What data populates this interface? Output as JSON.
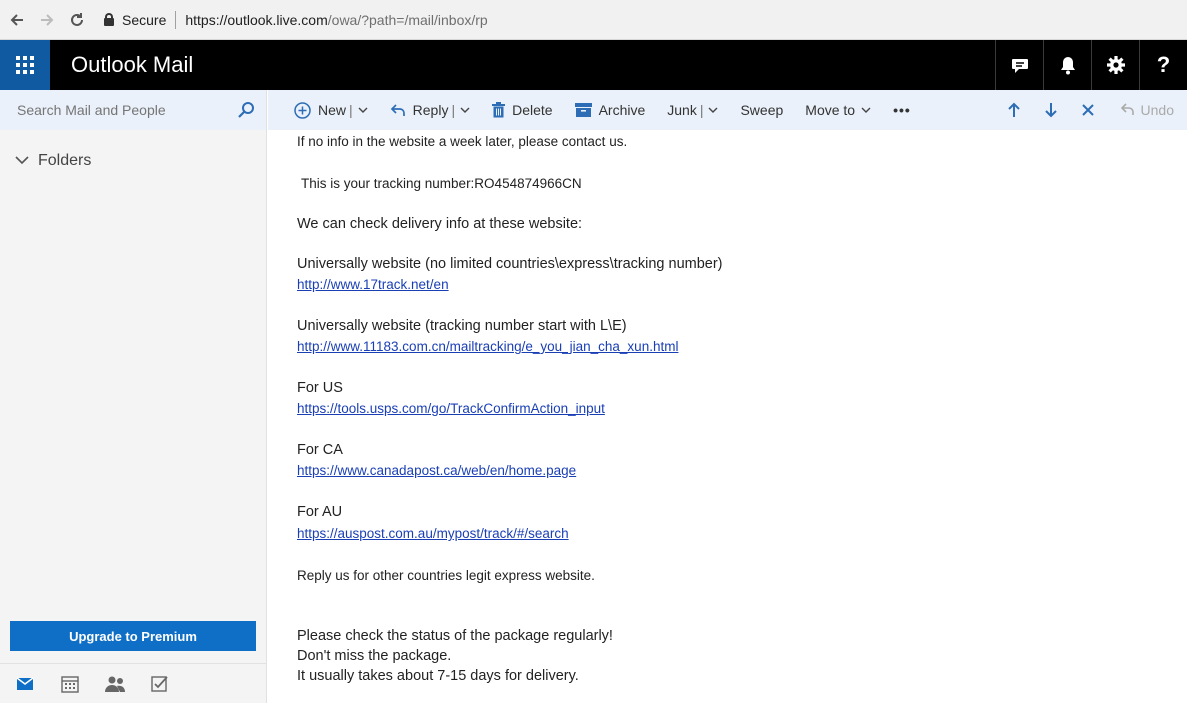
{
  "browser": {
    "secure_label": "Secure",
    "url_host": "https://outlook.live.com",
    "url_path": "/owa/?path=/mail/inbox/rp"
  },
  "header": {
    "app_title": "Outlook Mail",
    "help_label": "?"
  },
  "sidebar": {
    "search_placeholder": "Search Mail and People",
    "folders_label": "Folders",
    "upgrade_label": "Upgrade to Premium"
  },
  "toolbar": {
    "new_label": "New",
    "reply_label": "Reply",
    "delete_label": "Delete",
    "archive_label": "Archive",
    "junk_label": "Junk",
    "sweep_label": "Sweep",
    "moveto_label": "Move to",
    "more_label": "•••",
    "undo_label": "Undo",
    "separator": "|"
  },
  "message": {
    "line_contact": "If no info in the website a week later, please contact us.",
    "tracking_number": "This is your tracking number:RO454874966CN",
    "check_info": "We can check delivery info at these website:",
    "site1_label": "Universally website (no limited countries\\express\\tracking number)",
    "site1_url": "http://www.17track.net/en",
    "site2_label": "Universally website (tracking number start with L\\E)",
    "site2_url": "http://www.11183.com.cn/mailtracking/e_you_jian_cha_xun.html",
    "us_label": "For US",
    "us_url": "https://tools.usps.com/go/TrackConfirmAction_input",
    "ca_label": "For CA",
    "ca_url": "https://www.canadapost.ca/web/en/home.page",
    "au_label": "For AU",
    "au_url": "https://auspost.com.au/mypost/track/#/search",
    "reply_other": "Reply us for other countries legit express website.",
    "check_status": "Please check the status of the package regularly!",
    "dont_miss": "Don't miss the package.",
    "usually_takes": "It usually takes about 7-15 days for delivery."
  },
  "colors": {
    "accent": "#0f6fc6",
    "header_bg": "#000000",
    "link": "#1a3fb5"
  }
}
